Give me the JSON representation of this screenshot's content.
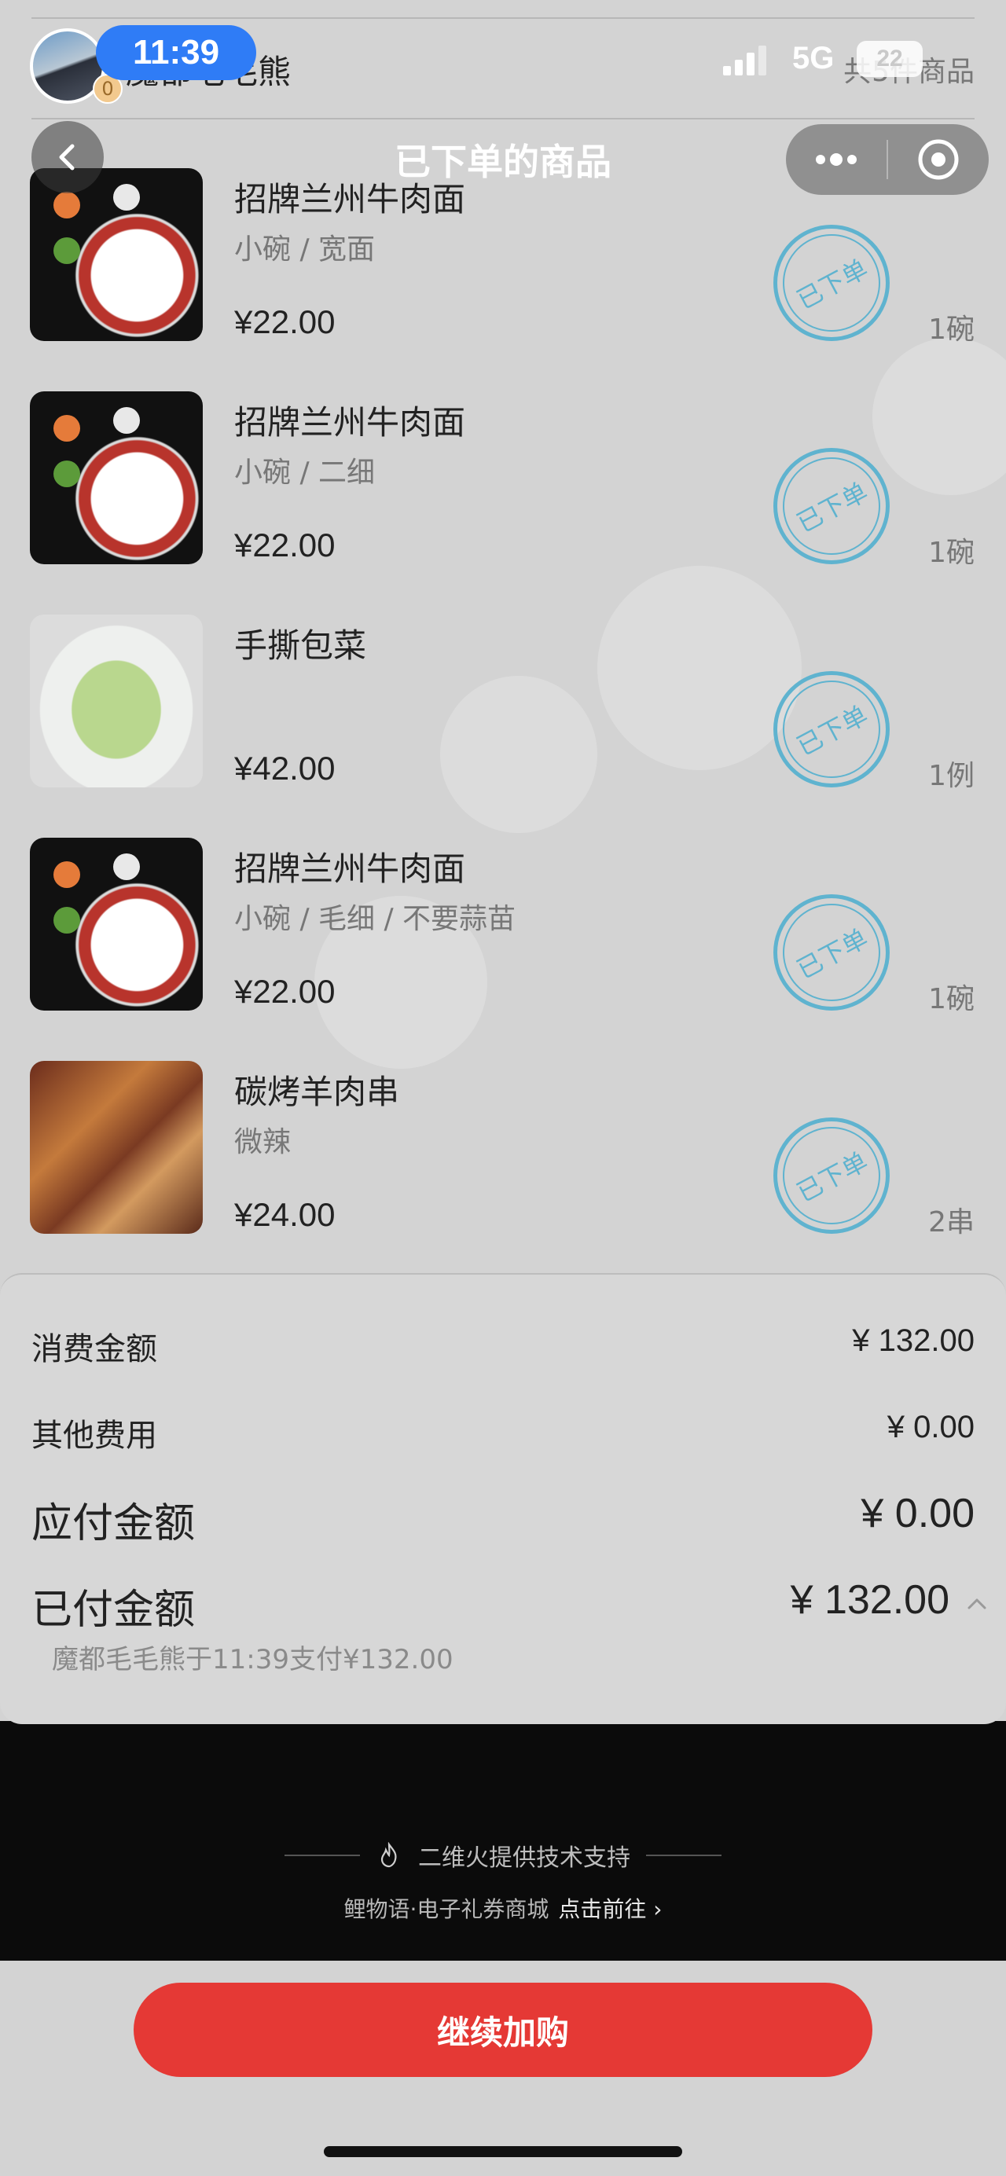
{
  "status_bar": {
    "time": "11:39",
    "network": "5G",
    "battery": "22"
  },
  "shop": {
    "name": "魔都毛毛熊",
    "badge": "0",
    "item_count": "共5件商品"
  },
  "nav": {
    "title": "已下单的商品"
  },
  "items": [
    {
      "name": "招牌兰州牛肉面",
      "spec": "小碗 / 宽面",
      "price": "¥22.00",
      "qty": "1碗",
      "stamp": "已下单"
    },
    {
      "name": "招牌兰州牛肉面",
      "spec": "小碗 / 二细",
      "price": "¥22.00",
      "qty": "1碗",
      "stamp": "已下单"
    },
    {
      "name": "手撕包菜",
      "spec": "",
      "price": "¥42.00",
      "qty": "1例",
      "stamp": "已下单"
    },
    {
      "name": "招牌兰州牛肉面",
      "spec": "小碗 / 毛细 / 不要蒜苗",
      "price": "¥22.00",
      "qty": "1碗",
      "stamp": "已下单"
    },
    {
      "name": "碳烤羊肉串",
      "spec": "微辣",
      "price": "¥24.00",
      "qty": "2串",
      "stamp": "已下单"
    }
  ],
  "summary": {
    "consumption_label": "消费金额",
    "consumption_value": "¥ 132.00",
    "other_label": "其他费用",
    "other_value": "¥ 0.00",
    "payable_label": "应付金额",
    "payable_value": "¥ 0.00",
    "paid_label": "已付金额",
    "paid_value": "¥ 132.00",
    "pay_note": "魔都毛毛熊于11:39支付¥132.00"
  },
  "footer": {
    "support_text": "二维火提供技术支持",
    "mall_text": "鲤物语·电子礼券商城",
    "mall_link": "点击前往 ›"
  },
  "action": {
    "continue_label": "继续加购"
  },
  "colors": {
    "accent_red": "#e53935",
    "stamp_blue": "#5fb3cf",
    "time_pill_blue": "#2f7cf6"
  }
}
